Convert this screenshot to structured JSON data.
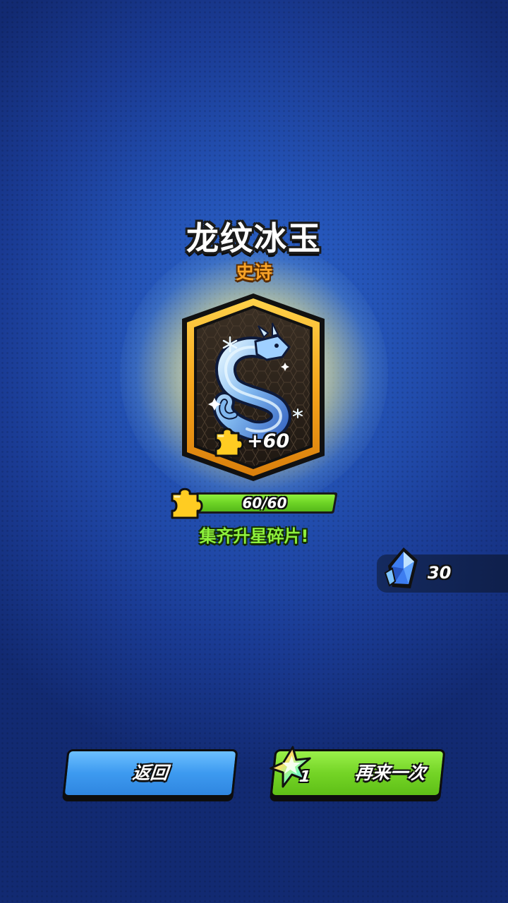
{
  "item": {
    "name": "龙纹冰玉",
    "rarity": "史诗",
    "rarity_color": "#f7a328",
    "shard_gain": "+60",
    "icon": "ice-dragon-jade-icon"
  },
  "progress": {
    "text": "60/60",
    "current": 60,
    "max": 60,
    "fill_fraction": 1.0,
    "message": "集齐升星碎片!",
    "bar_color": "#6dd326"
  },
  "currency": {
    "value": "30",
    "icon": "blue-crystal-icon"
  },
  "buttons": {
    "back_label": "返回",
    "back_color": "#3d9af0",
    "again_label": "再来一次",
    "again_color": "#74d426",
    "again_ticket_count": "1",
    "again_icon": "rainbow-star-ticket-icon"
  }
}
